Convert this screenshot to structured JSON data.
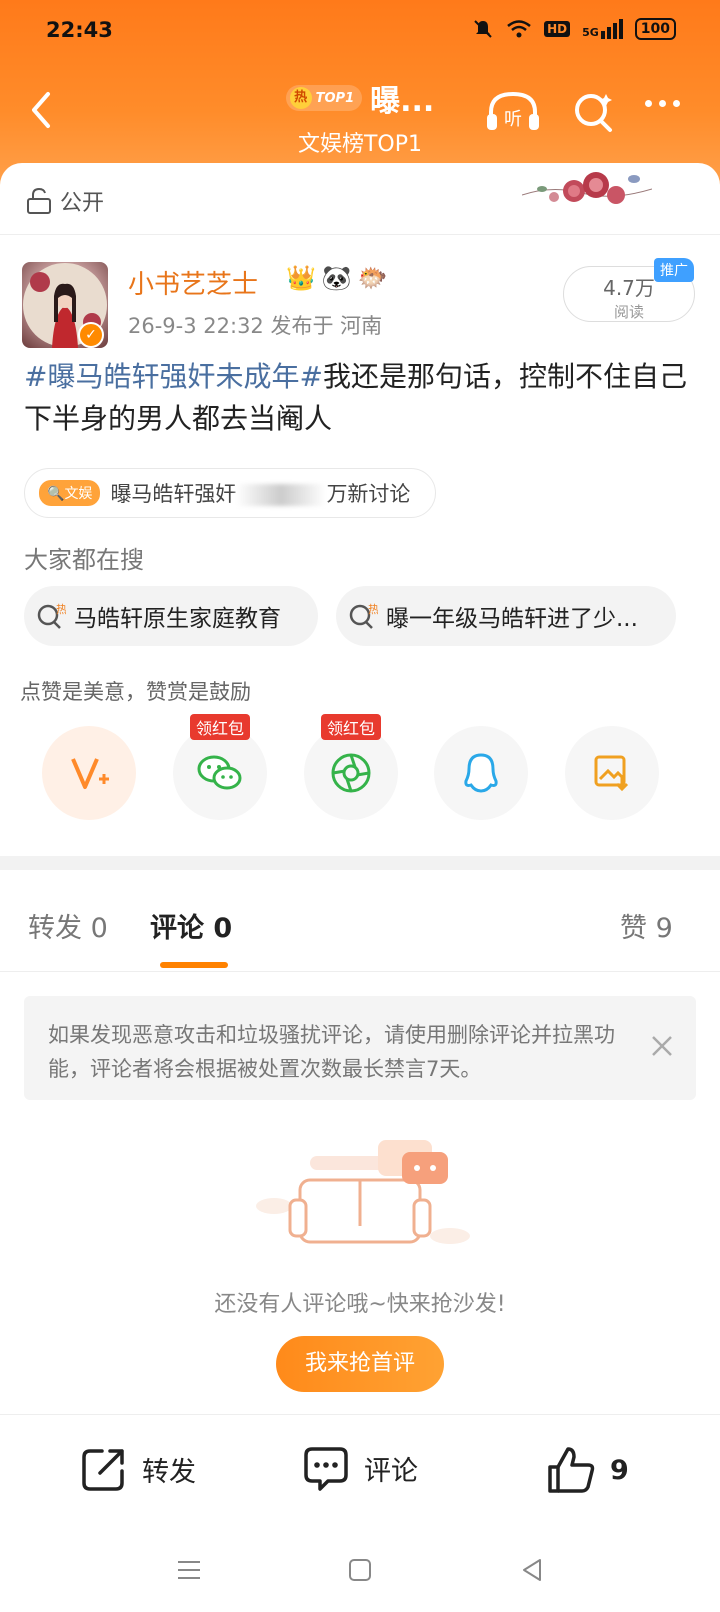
{
  "status": {
    "time": "22:43",
    "battery": "100",
    "network": "5G",
    "hd": "HD"
  },
  "nav": {
    "hot_badge": "热",
    "hot_rank": "TOP1",
    "title": "曝...",
    "subtitle": "文娱榜TOP1"
  },
  "visibility": {
    "label": "公开"
  },
  "post": {
    "author": "小书艺芝士",
    "meta": "26-9-3 22:32   发布于 河南",
    "reads": "4.7万",
    "reads_label": "阅读",
    "promo": "推广",
    "hashtag": "#曝马皓轩强奸未成年#",
    "text": "我还是那句话，控制不住自己下半身的男人都去当阉人",
    "topic_tag": "文娱",
    "topic_text_a": "曝马皓轩强奸",
    "topic_text_b": "万新讨论"
  },
  "search": {
    "title": "大家都在搜",
    "items": [
      "马皓轩原生家庭教育",
      "曝一年级马皓轩进了少..."
    ]
  },
  "share": {
    "encourage": "点赞是美意，赞赏是鼓励",
    "red_packet": "领红包"
  },
  "tabs": {
    "repost": "转发 0",
    "comment": "评论 0",
    "like": "赞 9"
  },
  "notice": "如果发现恶意攻击和垃圾骚扰评论，请使用删除评论并拉黑功能，评论者将会根据被处置次数最长禁言7天。",
  "empty": {
    "text": "还没有人评论哦~快来抢沙发!",
    "button": "我来抢首评"
  },
  "bottom": {
    "repost": "转发",
    "comment": "评论",
    "like_count": "9"
  },
  "colors": {
    "brand": "#ff8200",
    "hashtag": "#4a6fa0",
    "author": "#e8751a"
  }
}
